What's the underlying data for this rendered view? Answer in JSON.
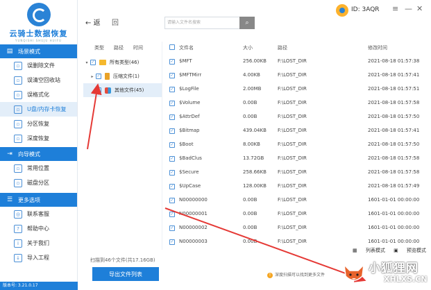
{
  "app": {
    "logo_title": "云骑士数据恢复",
    "logo_sub": "YUNQISHI SHUJU HUIFU",
    "version": "版本号: 3.21.0.17",
    "device_id": "ID: 3AQR"
  },
  "sidebar": {
    "sections": [
      {
        "title": "场景模式",
        "items": [
          {
            "label": "误删除文件",
            "active": false
          },
          {
            "label": "误清空回收站",
            "active": false
          },
          {
            "label": "误格式化",
            "active": false
          },
          {
            "label": "U盘/内存卡恢复",
            "active": true
          },
          {
            "label": "分区恢复",
            "active": false
          },
          {
            "label": "深度恢复",
            "active": false
          }
        ]
      },
      {
        "title": "向导模式",
        "items": [
          {
            "label": "常用位置",
            "active": false
          },
          {
            "label": "磁盘分区",
            "active": false
          }
        ]
      },
      {
        "title": "更多选项",
        "items": [
          {
            "label": "联系客服",
            "active": false
          },
          {
            "label": "帮助中心",
            "active": false
          },
          {
            "label": "关于我们",
            "active": false
          },
          {
            "label": "导入工程",
            "active": false
          }
        ]
      }
    ]
  },
  "toolbar": {
    "back_label": "返",
    "refresh_label": "回",
    "search_placeholder": "请输入文件名搜索",
    "search_icon": "search-icon"
  },
  "tree": {
    "headers": [
      "类型",
      "路径",
      "时间"
    ],
    "rows": [
      {
        "label": "所有类型(46)",
        "icon": "folder"
      },
      {
        "label": "压缩文件(1)",
        "icon": "zip"
      },
      {
        "label": "其他文件(45)",
        "icon": "multi"
      }
    ],
    "scan_count": "扫描到46个文件(共17.16GB)",
    "export_label": "导出文件列表"
  },
  "table": {
    "headers": {
      "name": "文件名",
      "size": "大小",
      "path": "路径",
      "time": "修改时间"
    },
    "rows": [
      {
        "name": "$MFT",
        "size": "256.00KB",
        "path": "F:\\LOST_DIR",
        "time": "2021-08-18 01:57:38"
      },
      {
        "name": "$MFTMirr",
        "size": "4.00KB",
        "path": "F:\\LOST_DIR",
        "time": "2021-08-18 01:57:41"
      },
      {
        "name": "$LogFile",
        "size": "2.00MB",
        "path": "F:\\LOST_DIR",
        "time": "2021-08-18 01:57:51"
      },
      {
        "name": "$Volume",
        "size": "0.00B",
        "path": "F:\\LOST_DIR",
        "time": "2021-08-18 01:57:58"
      },
      {
        "name": "$AttrDef",
        "size": "0.00B",
        "path": "F:\\LOST_DIR",
        "time": "2021-08-18 01:57:50"
      },
      {
        "name": "$Bitmap",
        "size": "439.04KB",
        "path": "F:\\LOST_DIR",
        "time": "2021-08-18 01:57:41"
      },
      {
        "name": "$Boot",
        "size": "8.00KB",
        "path": "F:\\LOST_DIR",
        "time": "2021-08-18 01:57:50"
      },
      {
        "name": "$BadClus",
        "size": "13.72GB",
        "path": "F:\\LOST_DIR",
        "time": "2021-08-18 01:57:58"
      },
      {
        "name": "$Secure",
        "size": "258.66KB",
        "path": "F:\\LOST_DIR",
        "time": "2021-08-18 01:57:58"
      },
      {
        "name": "$UpCase",
        "size": "128.00KB",
        "path": "F:\\LOST_DIR",
        "time": "2021-08-18 01:57:49"
      },
      {
        "name": "N00000000",
        "size": "0.00B",
        "path": "F:\\LOST_DIR",
        "time": "1601-01-01 00:00:00"
      },
      {
        "name": "N00000001",
        "size": "0.00B",
        "path": "F:\\LOST_DIR",
        "time": "1601-01-01 00:00:00"
      },
      {
        "name": "N00000002",
        "size": "0.00B",
        "path": "F:\\LOST_DIR",
        "time": "1601-01-01 00:00:00"
      },
      {
        "name": "N00000003",
        "size": "0.00B",
        "path": "F:\\LOST_DIR",
        "time": "1601-01-01 00:00:00"
      }
    ]
  },
  "view_modes": {
    "list": "列表模式",
    "preview": "预览模式"
  },
  "tip": "深度扫描可以找到更多文件",
  "watermark": {
    "text": "小狐狸网",
    "url": "XHLXS.CN"
  },
  "colors": {
    "brand": "#1e7fd9",
    "annotation": "#e53935"
  }
}
